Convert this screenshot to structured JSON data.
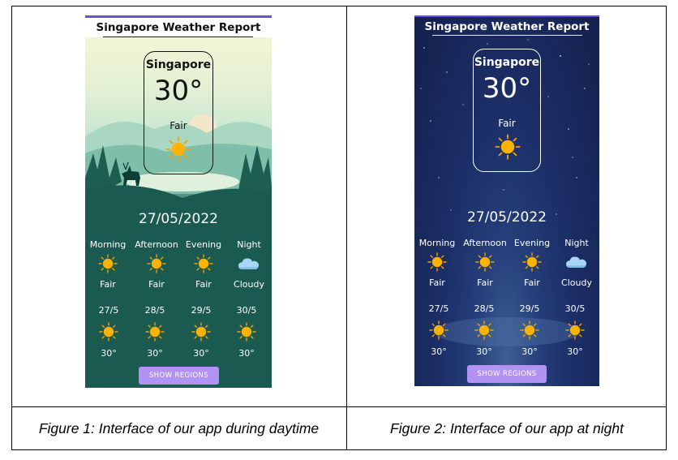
{
  "figures": [
    {
      "app": {
        "title": "Singapore Weather Report",
        "city": "Singapore",
        "temperature": "30°",
        "condition": "Fair",
        "date": "27/05/2022",
        "periods": [
          {
            "label": "Morning",
            "condition": "Fair",
            "icon": "sun-icon"
          },
          {
            "label": "Afternoon",
            "condition": "Fair",
            "icon": "sun-icon"
          },
          {
            "label": "Evening",
            "condition": "Fair",
            "icon": "sun-icon"
          },
          {
            "label": "Night",
            "condition": "Cloudy",
            "icon": "cloud-icon"
          }
        ],
        "forecast": [
          {
            "day": "27/5",
            "temp": "30°",
            "icon": "sun-icon"
          },
          {
            "day": "28/5",
            "temp": "30°",
            "icon": "sun-icon"
          },
          {
            "day": "29/5",
            "temp": "30°",
            "icon": "sun-icon"
          },
          {
            "day": "30/5",
            "temp": "30°",
            "icon": "sun-icon"
          }
        ],
        "button_label": "SHOW REGIONS"
      },
      "caption": "Figure 1: Interface of our app during daytime"
    },
    {
      "app": {
        "title": "Singapore Weather Report",
        "city": "Singapore",
        "temperature": "30°",
        "condition": "Fair",
        "date": "27/05/2022",
        "periods": [
          {
            "label": "Morning",
            "condition": "Fair",
            "icon": "sun-icon"
          },
          {
            "label": "Afternoon",
            "condition": "Fair",
            "icon": "sun-icon"
          },
          {
            "label": "Evening",
            "condition": "Fair",
            "icon": "sun-icon"
          },
          {
            "label": "Night",
            "condition": "Cloudy",
            "icon": "cloud-icon"
          }
        ],
        "forecast": [
          {
            "day": "27/5",
            "temp": "30°",
            "icon": "sun-icon"
          },
          {
            "day": "28/5",
            "temp": "30°",
            "icon": "sun-icon"
          },
          {
            "day": "29/5",
            "temp": "30°",
            "icon": "sun-icon"
          },
          {
            "day": "30/5",
            "temp": "30°",
            "icon": "sun-icon"
          }
        ],
        "button_label": "SHOW REGIONS"
      },
      "caption": "Figure 2: Interface of our app at night"
    }
  ],
  "colors": {
    "sun": "#ffb300",
    "sun_ray": "#f5a000",
    "button": "#b293f3",
    "accent_bar": "#6a4fd8",
    "cloud": "#9fd0f2"
  }
}
